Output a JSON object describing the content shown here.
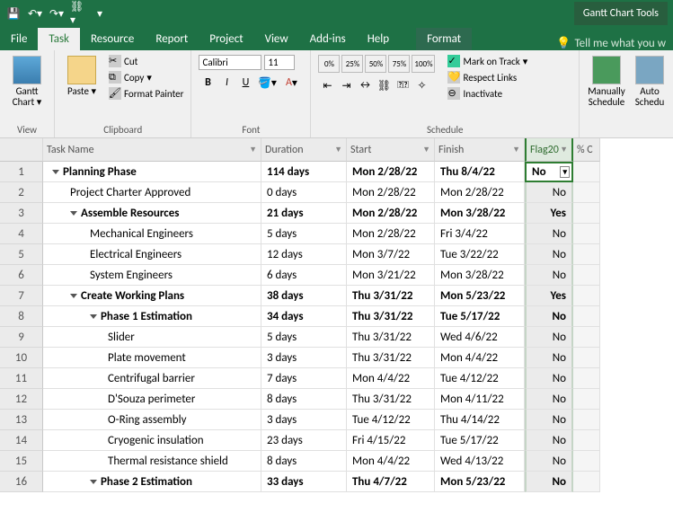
{
  "qat": {
    "context_title": "Gantt Chart Tools"
  },
  "tabs": {
    "file": "File",
    "task": "Task",
    "resource": "Resource",
    "report": "Report",
    "project": "Project",
    "view": "View",
    "addins": "Add-ins",
    "help": "Help",
    "format": "Format",
    "tellme": "Tell me what you w"
  },
  "ribbon": {
    "view": {
      "gantt": "Gantt Chart",
      "label": "View"
    },
    "clipboard": {
      "paste": "Paste",
      "cut": "Cut",
      "copy": "Copy",
      "format_painter": "Format Painter",
      "label": "Clipboard"
    },
    "font": {
      "face": "Calibri",
      "size": "11",
      "label": "Font"
    },
    "schedule": {
      "p0": "0%",
      "p25": "25%",
      "p50": "50%",
      "p75": "75%",
      "p100": "100%",
      "mark": "Mark on Track",
      "respect": "Respect Links",
      "inactivate": "Inactivate",
      "label": "Schedule"
    },
    "tasks_group": {
      "manual": "Manually Schedule",
      "auto": "Auto Schedu"
    }
  },
  "columns": {
    "taskname": "Task Name",
    "duration": "Duration",
    "start": "Start",
    "finish": "Finish",
    "flag": "Flag20",
    "percent": "% C"
  },
  "rows": [
    {
      "n": 1,
      "bold": true,
      "indent": 1,
      "toggle": true,
      "name": "Planning Phase",
      "dur": "114 days",
      "start": "Mon 2/28/22",
      "finish": "Thu 8/4/22",
      "flag": "No",
      "selected": true
    },
    {
      "n": 2,
      "bold": false,
      "indent": 2,
      "toggle": false,
      "name": "Project Charter Approved",
      "dur": "0 days",
      "start": "Mon 2/28/22",
      "finish": "Mon 2/28/22",
      "flag": "No"
    },
    {
      "n": 3,
      "bold": true,
      "indent": 2,
      "toggle": true,
      "name": "Assemble Resources",
      "dur": "21 days",
      "start": "Mon 2/28/22",
      "finish": "Mon 3/28/22",
      "flag": "Yes"
    },
    {
      "n": 4,
      "bold": false,
      "indent": 3,
      "toggle": false,
      "name": "Mechanical Engineers",
      "dur": "5 days",
      "start": "Mon 2/28/22",
      "finish": "Fri 3/4/22",
      "flag": "No"
    },
    {
      "n": 5,
      "bold": false,
      "indent": 3,
      "toggle": false,
      "name": "Electrical Engineers",
      "dur": "12 days",
      "start": "Mon 3/7/22",
      "finish": "Tue 3/22/22",
      "flag": "No"
    },
    {
      "n": 6,
      "bold": false,
      "indent": 3,
      "toggle": false,
      "name": "System Engineers",
      "dur": "6 days",
      "start": "Mon 3/21/22",
      "finish": "Mon 3/28/22",
      "flag": "No"
    },
    {
      "n": 7,
      "bold": true,
      "indent": 2,
      "toggle": true,
      "name": "Create Working Plans",
      "dur": "38 days",
      "start": "Thu 3/31/22",
      "finish": "Mon 5/23/22",
      "flag": "Yes"
    },
    {
      "n": 8,
      "bold": true,
      "indent": 3,
      "toggle": true,
      "name": "Phase 1 Estimation",
      "dur": "34 days",
      "start": "Thu 3/31/22",
      "finish": "Tue 5/17/22",
      "flag": "No"
    },
    {
      "n": 9,
      "bold": false,
      "indent": 4,
      "toggle": false,
      "name": "Slider",
      "dur": "5 days",
      "start": "Thu 3/31/22",
      "finish": "Wed 4/6/22",
      "flag": "No"
    },
    {
      "n": 10,
      "bold": false,
      "indent": 4,
      "toggle": false,
      "name": "Plate movement",
      "dur": "3 days",
      "start": "Thu 3/31/22",
      "finish": "Mon 4/4/22",
      "flag": "No"
    },
    {
      "n": 11,
      "bold": false,
      "indent": 4,
      "toggle": false,
      "name": "Centrifugal barrier",
      "dur": "7 days",
      "start": "Mon 4/4/22",
      "finish": "Tue 4/12/22",
      "flag": "No"
    },
    {
      "n": 12,
      "bold": false,
      "indent": 4,
      "toggle": false,
      "name": "D'Souza perimeter",
      "dur": "8 days",
      "start": "Thu 3/31/22",
      "finish": "Mon 4/11/22",
      "flag": "No"
    },
    {
      "n": 13,
      "bold": false,
      "indent": 4,
      "toggle": false,
      "name": "O-Ring assembly",
      "dur": "3 days",
      "start": "Tue 4/12/22",
      "finish": "Thu 4/14/22",
      "flag": "No"
    },
    {
      "n": 14,
      "bold": false,
      "indent": 4,
      "toggle": false,
      "name": "Cryogenic insulation",
      "dur": "23 days",
      "start": "Fri 4/15/22",
      "finish": "Tue 5/17/22",
      "flag": "No"
    },
    {
      "n": 15,
      "bold": false,
      "indent": 4,
      "toggle": false,
      "name": "Thermal resistance shield",
      "dur": "8 days",
      "start": "Mon 4/4/22",
      "finish": "Wed 4/13/22",
      "flag": "No"
    },
    {
      "n": 16,
      "bold": true,
      "indent": 3,
      "toggle": true,
      "name": "Phase 2 Estimation",
      "dur": "33 days",
      "start": "Thu 4/7/22",
      "finish": "Mon 5/23/22",
      "flag": "No"
    }
  ]
}
